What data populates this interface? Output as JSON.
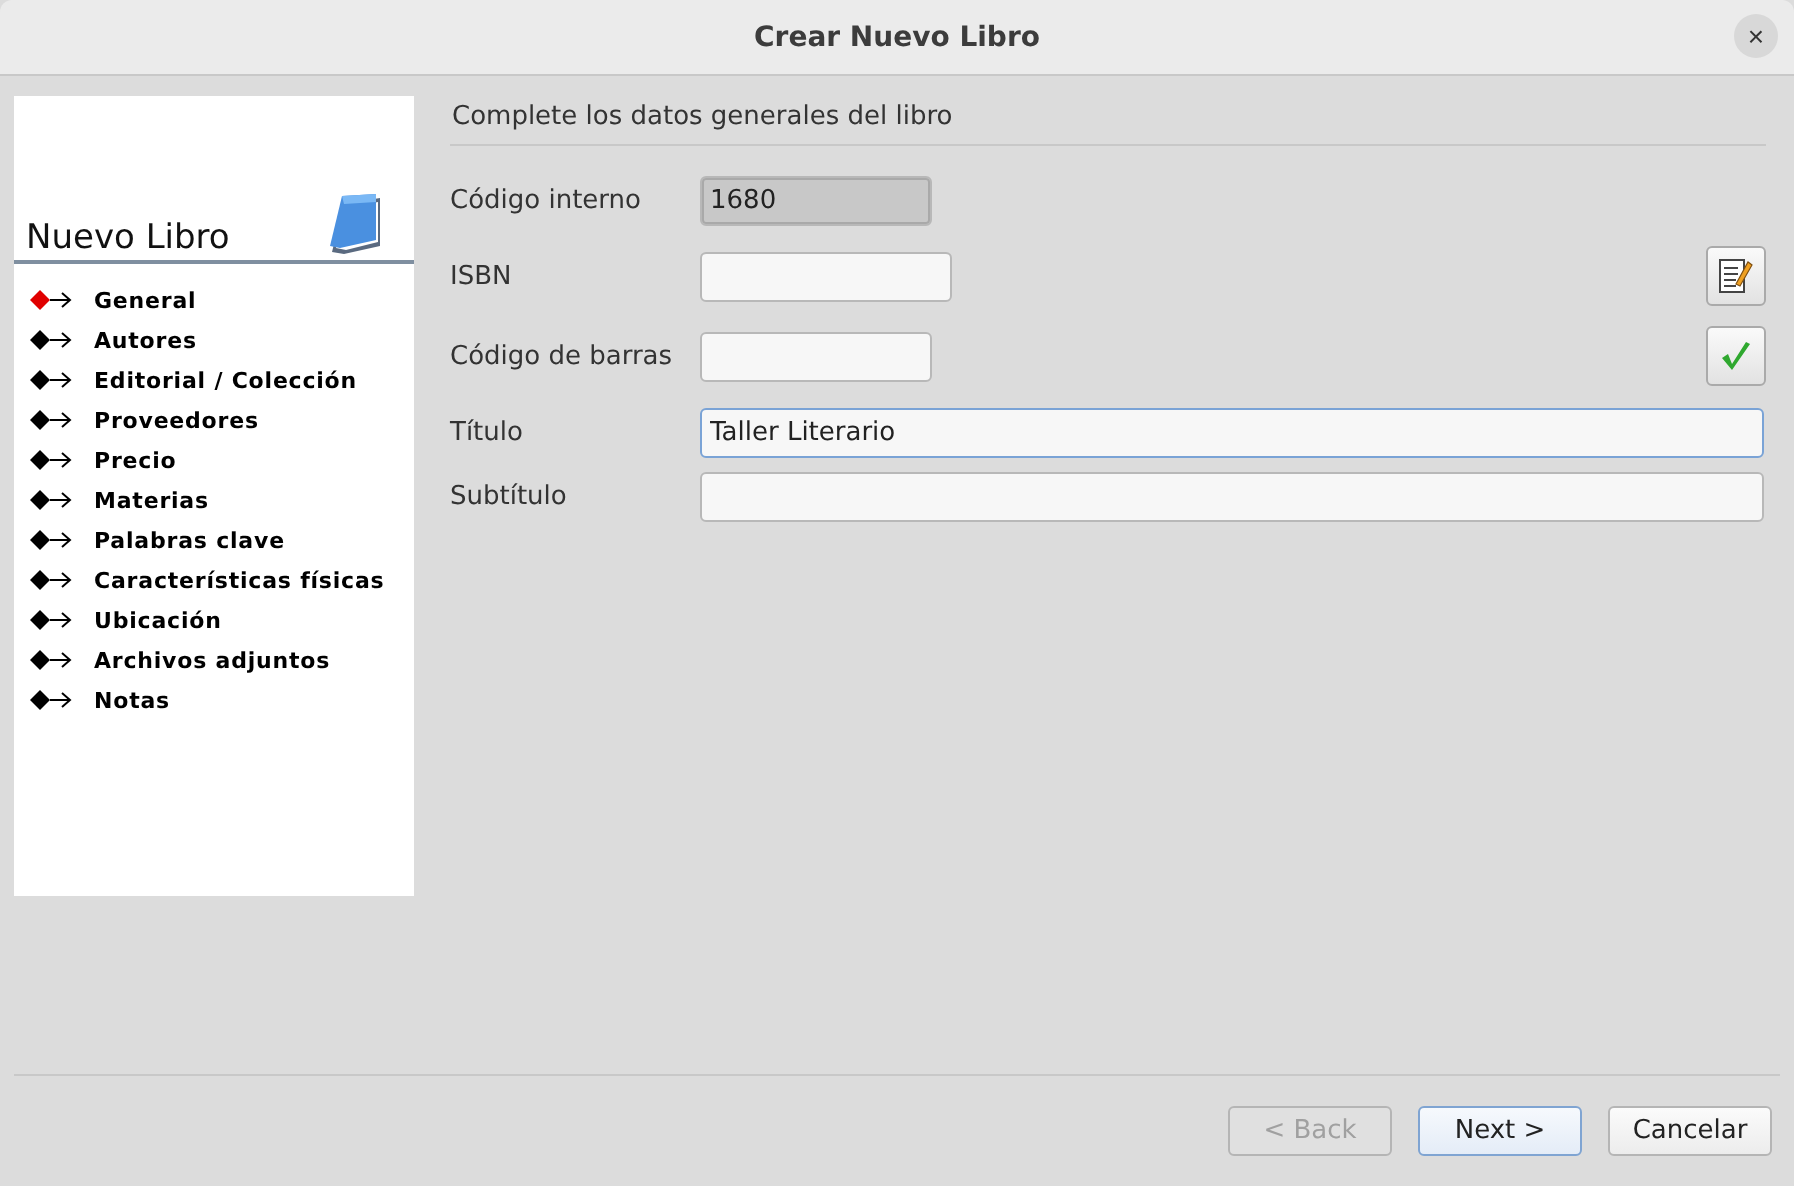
{
  "window": {
    "title": "Crear Nuevo Libro",
    "close": "×"
  },
  "sidebar": {
    "title": "Nuevo Libro",
    "items": [
      {
        "label": "General",
        "selected": true
      },
      {
        "label": "Autores",
        "selected": false
      },
      {
        "label": "Editorial / Colección",
        "selected": false
      },
      {
        "label": "Proveedores",
        "selected": false
      },
      {
        "label": "Precio",
        "selected": false
      },
      {
        "label": "Materias",
        "selected": false
      },
      {
        "label": "Palabras clave",
        "selected": false
      },
      {
        "label": "Características físicas",
        "selected": false
      },
      {
        "label": "Ubicación",
        "selected": false
      },
      {
        "label": "Archivos adjuntos",
        "selected": false
      },
      {
        "label": "Notas",
        "selected": false
      }
    ]
  },
  "form": {
    "heading": "Complete los datos generales del libro",
    "fields": [
      {
        "label": "Código interno",
        "value": "1680",
        "kind": "short",
        "disabled": true,
        "focused": false
      },
      {
        "label": "ISBN",
        "kind": "short-edit",
        "disabled": false,
        "focused": false
      },
      {
        "label": "Código de barras",
        "kind": "short-check",
        "disabled": false,
        "focused": false
      },
      {
        "label": "Título",
        "value": "Taller Literario",
        "kind": "wide",
        "disabled": false,
        "focused": true
      },
      {
        "label": "Subtítulo",
        "kind": "wide",
        "disabled": false,
        "focused": false
      }
    ]
  },
  "buttons": [
    {
      "label": "< Back",
      "disabled": true,
      "default": false
    },
    {
      "label": "Next >",
      "disabled": false,
      "default": true
    },
    {
      "label": "Cancelar",
      "disabled": false,
      "default": false
    }
  ]
}
